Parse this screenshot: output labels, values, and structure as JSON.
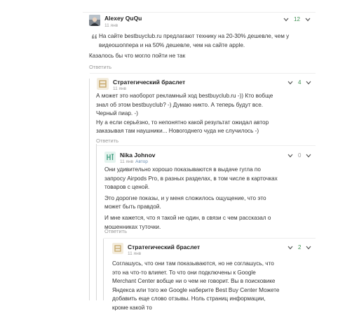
{
  "comments": [
    {
      "author": "Alexey QuQu",
      "time": "11 янв",
      "score": "12",
      "quote": "На сайте bestbuyclub.ru предлагают технику на 20-30% дешевле, чем у видеошоппера и на 50% дешевле, чем на сайте apple.",
      "body": "Казалось бы что могло пойти не так",
      "reply_label": "Ответить"
    },
    {
      "author": "Стратегический браслет",
      "time": "11 янв",
      "score": "4",
      "paragraphs": [
        "А может это наоборот рекламный ход bestbuyclub.ru -)) Кто вобще знал об этом bestbuyclub? -) Думаю никто. А теперь будут все. Черный пиар. -)",
        "Ну а если серьёзно, то непонятно какой результат ожидал автор заказывая там наушники... Новогоднего чуда не случилось -)"
      ],
      "reply_label": "Ответить"
    },
    {
      "author": "Nika Johnov",
      "time": "11 янв",
      "role": "Автор",
      "score": "0",
      "paragraphs": [
        "Они удивительно хорошо показываются в выдаче гугла по запросу Airpods Pro, в разных разделах, в том числе в карточках товаров с ценой.",
        "Это дорогие показы, и у меня сложилось ощущение, что это может быть правдой.",
        "И мне кажется, что я такой не один, в связи с чем рассказал о мошенниках туточки."
      ],
      "reply_label": "Ответить"
    },
    {
      "author": "Стратегический браслет",
      "time": "11 янв",
      "score": "2",
      "paragraphs": [
        "Соглашусь, что они там показываются, но не соглашусь, что это на что-то влияет. То что они подключены к Google Merchant Center вобще ни о чем не говорит. Вы в поисковике Яндекса или того же Google наберите Best Buy Center Можете добавить еще слово отзывы. Ноль страниц информации, кроме какой то"
      ]
    }
  ],
  "icons": {
    "expand": "chevron-down-icon",
    "more": "more-vertical-icon",
    "quote": "quote-icon"
  },
  "colors": {
    "positive_score": "#3f8f52",
    "neutral_score": "#999999",
    "author_role": "#6b8fb3",
    "thread_line": "#d8d8d8"
  }
}
